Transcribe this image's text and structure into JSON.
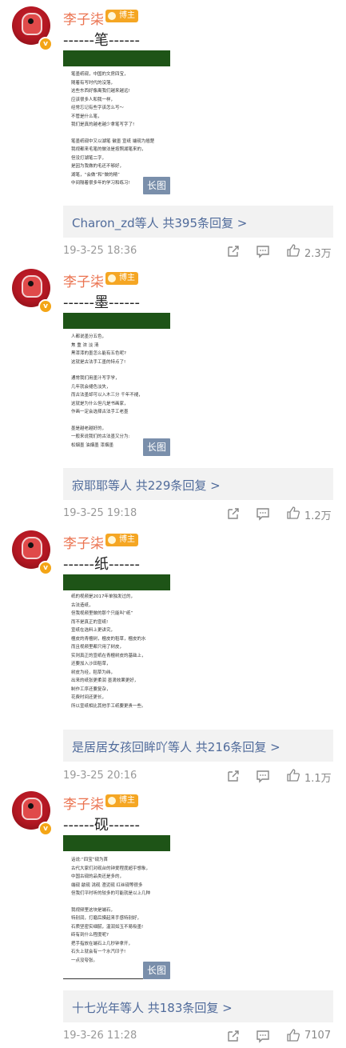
{
  "comments": [
    {
      "user": "李子柒",
      "badge": "博主",
      "heading": "------笔------",
      "article": [
        "笔墨纸砚，中国的文房四宝，",
        "随着有写时代的沒落，",
        "这些东西好像离我们越来越远!",
        "应该很多人和我一样，",
        "经常忘记有些字该怎么写～",
        "不管是什么笔，",
        "我们是真的越老越少拿笔写字了!",
        "",
        "笔墨纸砚中又以湖笔 徽墨 宣纸 端砚为翘楚",
        "我视都来毛笔的做法是按照湖笔来的，",
        "但没打湖笔二字，",
        "是因为我做的毛还不够好，",
        "湖笔，“会做”和“做的精”",
        "中间隔着很多年的学习和练习!"
      ],
      "long_image_label": "长图",
      "replies": "Charon_zd等人  共395条回复 >",
      "time": "19-3-25 18:36",
      "likes": "2.3万"
    },
    {
      "user": "李子柒",
      "badge": "博主",
      "heading": "------墨------",
      "article": [
        "人都说墨分五色，",
        "焦 重 浓 淡 清",
        "黑漆漆的墨怎么能有五色呢?",
        "这就是古法手工墨的特点了!",
        "",
        "通常我们用墨汁写字学，",
        "几年就会褪色淡失，",
        "而古法墨却可以入木三分 千年不褪，",
        "这就是为什么但凡是书画家，",
        "作画一定会选择古法手工老墨",
        "",
        "墨是越老越好的，",
        "一般来说我们的古法墨又分为:",
        "松烟墨 油烟墨 漆烟墨"
      ],
      "long_image_label": "长图",
      "replies": "寂耶耶等人  共229条回复 >",
      "time": "19-3-25 19:18",
      "likes": "1.2万"
    },
    {
      "user": "李子柒",
      "badge": "博主",
      "heading": "------纸------",
      "article": [
        "纸的视频是2017年单独发过的，",
        "古法造纸，",
        "但我视频里做的那个只能叫“纸”",
        "而不是真正的宣纸!",
        "宣纸在选料上更讲究，",
        "檀皮的青檀树，檀皮的稻草，檀皮的水",
        "而且视频里都只用了树皮，",
        "实则真正的宣纸在青檀树皮的基础上，",
        "还要加入沙田稻草，",
        "树皮为经，稻草为纬，",
        "出来的纸张更柔润 墨滴效果更好，",
        "制作工序还要复杂，",
        "花费时间还更长，",
        "所以宣纸相比其他手工纸要更贵一些。"
      ],
      "long_image_label": "",
      "replies": "是居居女孩回眸吖等人  共216条回复 >",
      "time": "19-3-25 20:16",
      "likes": "1.1万"
    },
    {
      "user": "李子柒",
      "badge": "博主",
      "heading": "------砚------",
      "article": [
        "话说:“四宝”砚为首",
        "古代大家们对砚台的钟爱程度超乎想象，",
        "中国古砚的品类还是多的，",
        "端砚 歙砚 洮砚 澄泥砚 红丝砚等很多",
        "但我们平时听的较多的可能就是以上几种",
        "",
        "我视频里这块是端石，",
        "特别润，打磨后摸起来手感特别好，",
        "石质坚密实细腻，温润如玉不易吸墨!",
        "砖有到什么程度呢?",
        "把手指放在端石上几秒钟拿开，",
        "石头上就会有一个水汽印子!",
        "一点没夸张。"
      ],
      "long_image_label": "长图",
      "replies": "十七光年等人  共183条回复 >",
      "time": "19-3-26 11:28",
      "likes": "7107"
    }
  ],
  "icons": {
    "share": "share-icon",
    "comment": "comment-icon",
    "like": "thumbs-up-icon"
  },
  "colors": {
    "username": "#eb7350",
    "link": "#506b9b",
    "badge": "#f5a623",
    "bar": "#1e5417"
  }
}
